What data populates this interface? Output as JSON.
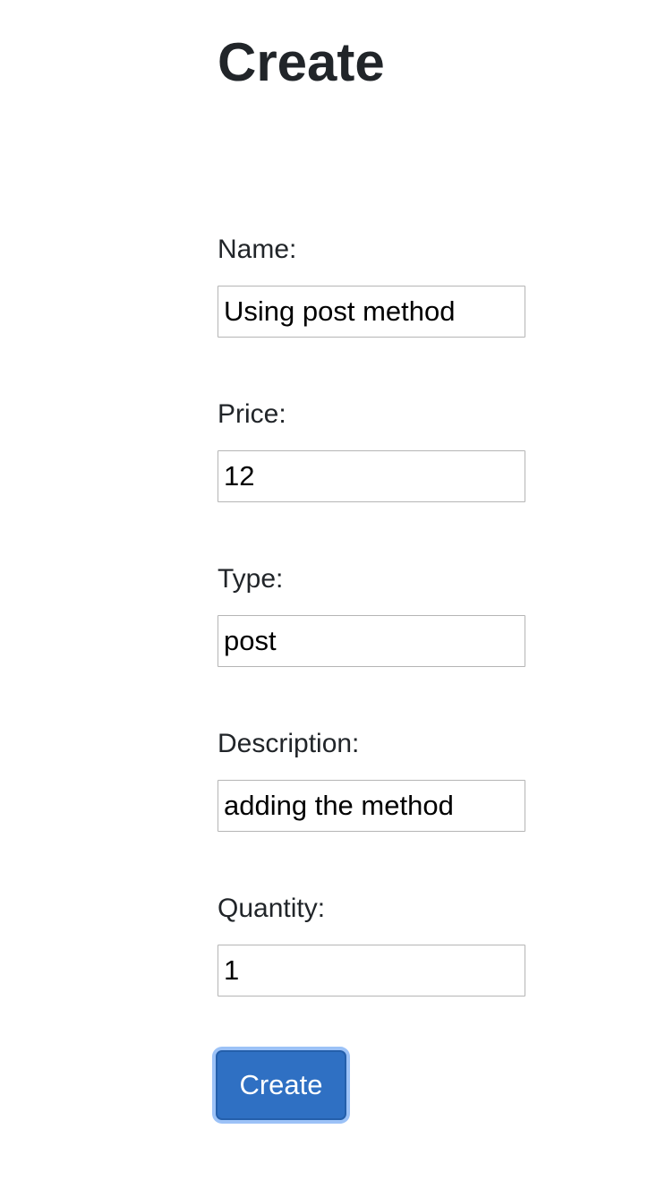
{
  "page": {
    "title": "Create"
  },
  "form": {
    "fields": [
      {
        "label": "Name:",
        "value": "Using post method"
      },
      {
        "label": "Price:",
        "value": "12"
      },
      {
        "label": "Type:",
        "value": "post"
      },
      {
        "label": "Description:",
        "value": "adding the method"
      },
      {
        "label": "Quantity:",
        "value": "1"
      }
    ],
    "submit_label": "Create"
  },
  "colors": {
    "button_bg": "#2f70c3",
    "button_focus_ring": "#9cc2f7",
    "text": "#212529",
    "input_border": "#b5b5b5"
  }
}
